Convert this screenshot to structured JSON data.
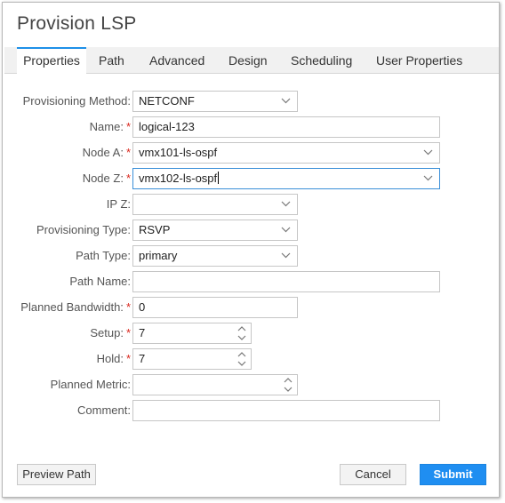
{
  "dialog": {
    "title": "Provision LSP"
  },
  "tabs": [
    {
      "label": "Properties",
      "active": true
    },
    {
      "label": "Path"
    },
    {
      "label": "Advanced"
    },
    {
      "label": "Design"
    },
    {
      "label": "Scheduling"
    },
    {
      "label": "User Properties"
    }
  ],
  "form": {
    "provisioning_method": {
      "label": "Provisioning Method:",
      "value": "NETCONF"
    },
    "name": {
      "label": "Name:",
      "value": "logical-123"
    },
    "node_a": {
      "label": "Node A:",
      "value": "vmx101-ls-ospf"
    },
    "node_z": {
      "label": "Node Z:",
      "value": "vmx102-ls-ospf"
    },
    "ip_z": {
      "label": "IP Z:",
      "value": ""
    },
    "provisioning_type": {
      "label": "Provisioning Type:",
      "value": "RSVP"
    },
    "path_type": {
      "label": "Path Type:",
      "value": "primary"
    },
    "path_name": {
      "label": "Path Name:",
      "value": ""
    },
    "planned_bandwidth": {
      "label": "Planned Bandwidth:",
      "value": "0"
    },
    "setup": {
      "label": "Setup:",
      "value": "7"
    },
    "hold": {
      "label": "Hold:",
      "value": "7"
    },
    "planned_metric": {
      "label": "Planned Metric:",
      "value": ""
    },
    "comment": {
      "label": "Comment:",
      "value": ""
    },
    "required_marker": "*"
  },
  "buttons": {
    "preview_path": "Preview Path",
    "cancel": "Cancel",
    "submit": "Submit"
  },
  "colors": {
    "accent": "#1e90e8",
    "primary_button": "#1f8ef1",
    "required": "#d9261c"
  }
}
